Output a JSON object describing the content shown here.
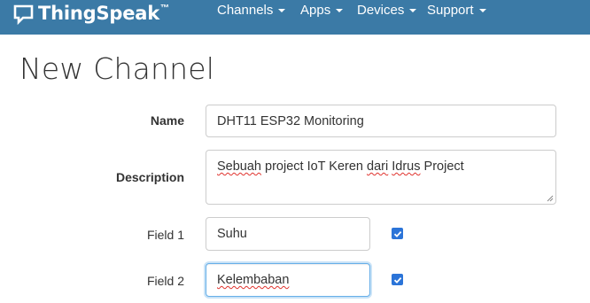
{
  "navbar": {
    "brand": {
      "name": "ThingSpeak",
      "trademark": "™",
      "icon": "speech-bubble-icon"
    },
    "items": [
      {
        "label": "Channels"
      },
      {
        "label": "Apps"
      },
      {
        "label": "Devices"
      },
      {
        "label": "Support"
      }
    ],
    "background_color": "#3b7aa6"
  },
  "page": {
    "title": "New Channel"
  },
  "form": {
    "name": {
      "label": "Name",
      "value": "DHT11 ESP32 Monitoring"
    },
    "description": {
      "label": "Description",
      "value_parts": [
        "Sebuah",
        " project IoT Keren ",
        "dari",
        " ",
        "Idrus",
        " Project"
      ]
    },
    "fields": [
      {
        "label": "Field 1",
        "value": "Suhu",
        "enabled": true
      },
      {
        "label": "Field 2",
        "value": "Kelembaban",
        "enabled": true
      }
    ]
  },
  "colors": {
    "focus_border": "#66afe9",
    "checkbox": "#2b74d8",
    "spellcheck": "#e0332e"
  }
}
